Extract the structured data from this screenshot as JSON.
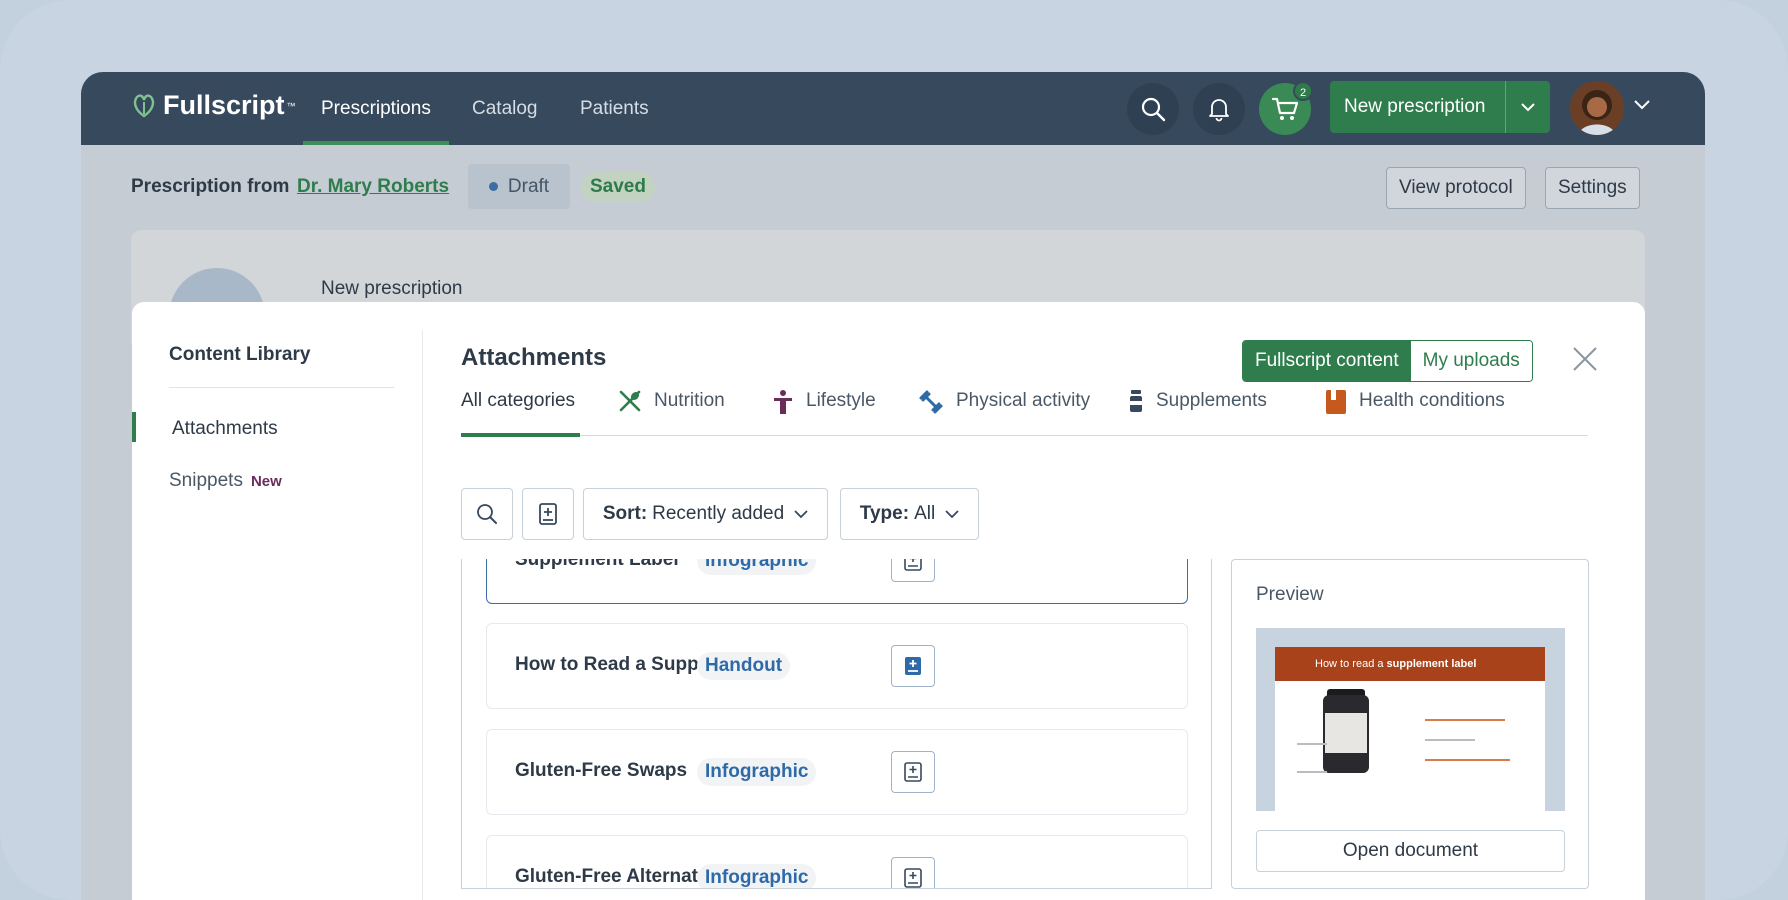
{
  "app": {
    "brand": "Fullscript",
    "brand_tm": "™"
  },
  "nav": {
    "links": [
      "Prescriptions",
      "Catalog",
      "Patients"
    ],
    "cart_count": "2",
    "new_prescription_label": "New prescription"
  },
  "subbar": {
    "prefix": "Prescription from",
    "doctor": "Dr. Mary Roberts",
    "status": "Draft",
    "saved": "Saved",
    "view_protocol": "View protocol",
    "settings": "Settings"
  },
  "card": {
    "label": "New prescription"
  },
  "library": {
    "title": "Content Library",
    "items": [
      "Attachments",
      "Snippets"
    ],
    "new_badge": "New"
  },
  "attachments": {
    "title": "Attachments",
    "source_tabs": [
      "Fullscript content",
      "My uploads"
    ],
    "categories": [
      "All categories",
      "Nutrition",
      "Lifestyle",
      "Physical activity",
      "Supplements",
      "Health conditions"
    ],
    "sort_label": "Sort:",
    "sort_value": "Recently added",
    "type_label": "Type:",
    "type_value": "All",
    "rows": [
      {
        "name": "Supplement Label",
        "tag": "Infographic"
      },
      {
        "name": "How to Read a Supp...",
        "tag": "Handout"
      },
      {
        "name": "Gluten-Free Swaps",
        "tag": "Infographic"
      },
      {
        "name": "Gluten-Free Alternat...",
        "tag": "Infographic"
      }
    ]
  },
  "preview": {
    "title": "Preview",
    "doc_header_prefix": "How to read a ",
    "doc_header_bold": "supplement label",
    "open_button": "Open document"
  },
  "colors": {
    "brand_green": "#2f7d4d",
    "nav_bg": "#36495d",
    "link_blue": "#2f6aa8"
  }
}
